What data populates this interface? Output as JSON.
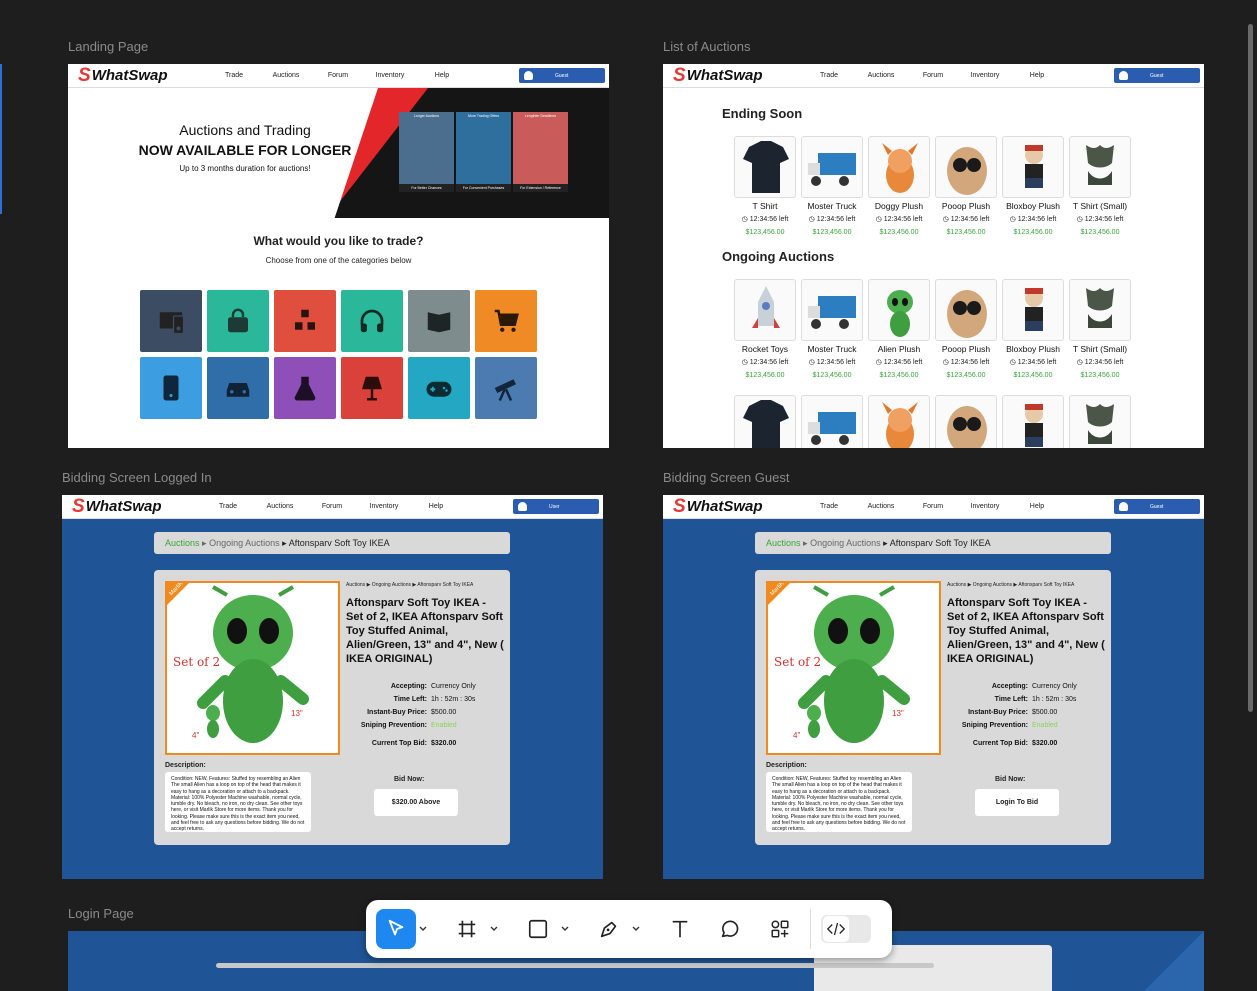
{
  "frames": {
    "landing": {
      "label": "Landing Page"
    },
    "list": {
      "label": "List of Auctions"
    },
    "bid_user": {
      "label": "Bidding Screen Logged In"
    },
    "bid_guest": {
      "label": "Bidding Screen Guest"
    },
    "login": {
      "label": "Login Page"
    }
  },
  "nav": {
    "logo": "WhatSwap",
    "logo_mark": "S",
    "links": [
      "Trade",
      "Auctions",
      "Forum",
      "Inventory",
      "Help"
    ],
    "guest_label": "Guest",
    "user_label": "User"
  },
  "landing": {
    "hero_line1": "Auctions and Trading",
    "hero_line2": "NOW AVAILABLE FOR LONGER",
    "hero_line3": "Up to 3 months duration for auctions!",
    "promos": [
      {
        "caption": "Longer Auctions",
        "footer": "For Better Chances"
      },
      {
        "caption": "More Trading Offers",
        "footer": "For Convenient Purchases"
      },
      {
        "caption": "Lengthier Deadlines",
        "footer": "For Extension / Reference"
      }
    ],
    "cat_title": "What would you like to trade?",
    "cat_subtitle": "Choose from one of the categories below",
    "categories": [
      {
        "icon": "computer-icon",
        "color": "#3c4d63"
      },
      {
        "icon": "bag-icon",
        "color": "#2bb89a"
      },
      {
        "icon": "cubes-icon",
        "color": "#e04e3e"
      },
      {
        "icon": "headphones-icon",
        "color": "#2bb89a"
      },
      {
        "icon": "book-icon",
        "color": "#7f8c8d"
      },
      {
        "icon": "cart-icon",
        "color": "#f08a24"
      },
      {
        "icon": "phone-icon",
        "color": "#3c9de0"
      },
      {
        "icon": "car-icon",
        "color": "#2f6ea8"
      },
      {
        "icon": "flask-icon",
        "color": "#8e4fb8"
      },
      {
        "icon": "lamp-icon",
        "color": "#d9413a"
      },
      {
        "icon": "gamepad-icon",
        "color": "#23a7c2"
      },
      {
        "icon": "telescope-icon",
        "color": "#4b7bb0"
      }
    ]
  },
  "list": {
    "ending_title": "Ending Soon",
    "ongoing_title": "Ongoing Auctions",
    "ending_items": [
      {
        "name": "T Shirt",
        "time": "12:34:56 left",
        "price": "$123,456.00"
      },
      {
        "name": "Moster Truck",
        "time": "12:34:56 left",
        "price": "$123,456.00"
      },
      {
        "name": "Doggy Plush",
        "time": "12:34:56 left",
        "price": "$123,456.00"
      },
      {
        "name": "Pooop Plush",
        "time": "12:34:56 left",
        "price": "$123,456.00"
      },
      {
        "name": "Bloxboy Plush",
        "time": "12:34:56 left",
        "price": "$123,456.00"
      },
      {
        "name": "T Shirt (Small)",
        "time": "12:34:56 left",
        "price": "$123,456.00"
      }
    ],
    "ongoing_items": [
      {
        "name": "Rocket Toys",
        "time": "12:34:56 left",
        "price": "$123,456.00"
      },
      {
        "name": "Moster Truck",
        "time": "12:34:56 left",
        "price": "$123,456.00"
      },
      {
        "name": "Alien Plush",
        "time": "12:34:56 left",
        "price": "$123,456.00"
      },
      {
        "name": "Pooop Plush",
        "time": "12:34:56 left",
        "price": "$123,456.00"
      },
      {
        "name": "Bloxboy Plush",
        "time": "12:34:56 left",
        "price": "$123,456.00"
      },
      {
        "name": "T Shirt (Small)",
        "time": "12:34:56 left",
        "price": "$123,456.00"
      }
    ]
  },
  "bidding": {
    "crumb1": "Auctions",
    "crumb2": "Ongoing Auctions",
    "crumb3": "Aftonsparv Soft Toy IKEA",
    "mini_crumb": "Auctions ▶ Ongoing Auctions ▶ Aftonsparv Soft Toy IKEA",
    "title": "Aftonsparv Soft Toy IKEA - Set of 2, IKEA Aftonsparv Soft Toy Stuffed Animal, Alien/Green, 13\" and 4\", New ( IKEA ORIGINAL)",
    "img_caption": "Set of 2",
    "img_size_big": "13\"",
    "img_size_small": "4\"",
    "img_corner": "MarliK",
    "accepting_k": "Accepting:",
    "accepting_v": "Currency Only",
    "time_k": "Time Left:",
    "time_v": "1h : 52m : 30s",
    "instant_k": "Instant-Buy Price:",
    "instant_v": "$500.00",
    "sniping_k": "Sniping Prevention:",
    "sniping_v": "Enabled",
    "top_k": "Current Top Bid:",
    "top_v": "$320.00",
    "desc_h": "Description:",
    "desc": "Condition: NEW, Features: Stuffed toy resembling an Alien The small Alien has a loop on top of the head that makes it easy to hang as a decoration or attach to a backpack. Material: 100% Polyester Machine washable, normal cycle, tumble dry. No bleach, no iron, no dry clean. See other toys here, or visit Marlik Store for more items. Thank you for looking. Please make sure this is the exact item you need, and feel free to ask any questions before bidding. We do not accept returns.",
    "bid_h": "Bid Now:",
    "bid_btn_user": "$320.00 Above",
    "bid_btn_guest": "Login To Bid"
  },
  "colors": {
    "accent": "#2f6fd6",
    "brand_red": "#e53935",
    "page_blue": "#1f5596",
    "price_green": "#3aa53a"
  }
}
